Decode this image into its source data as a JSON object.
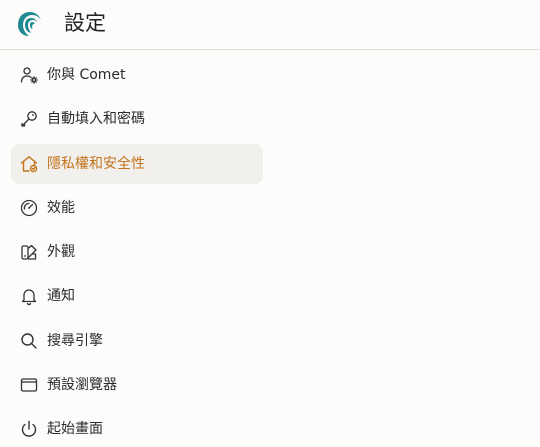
{
  "header": {
    "title": "設定",
    "logo_icon": "comet-logo-icon"
  },
  "colors": {
    "accent": "#c4731f",
    "active_bg": "#f1f0ec",
    "logo": "#1f8a93"
  },
  "sidebar": {
    "items": [
      {
        "label": "你與 Comet",
        "icon": "user-gear-icon",
        "active": false
      },
      {
        "label": "自動填入和密碼",
        "icon": "key-icon",
        "active": false
      },
      {
        "label": "隱私權和安全性",
        "icon": "home-shield-icon",
        "active": true
      },
      {
        "label": "效能",
        "icon": "speedometer-icon",
        "active": false
      },
      {
        "label": "外觀",
        "icon": "palette-icon",
        "active": false
      },
      {
        "label": "通知",
        "icon": "bell-icon",
        "active": false
      },
      {
        "label": "搜尋引擎",
        "icon": "search-icon",
        "active": false
      },
      {
        "label": "預設瀏覽器",
        "icon": "browser-window-icon",
        "active": false
      },
      {
        "label": "起始畫面",
        "icon": "power-icon",
        "active": false
      }
    ]
  }
}
